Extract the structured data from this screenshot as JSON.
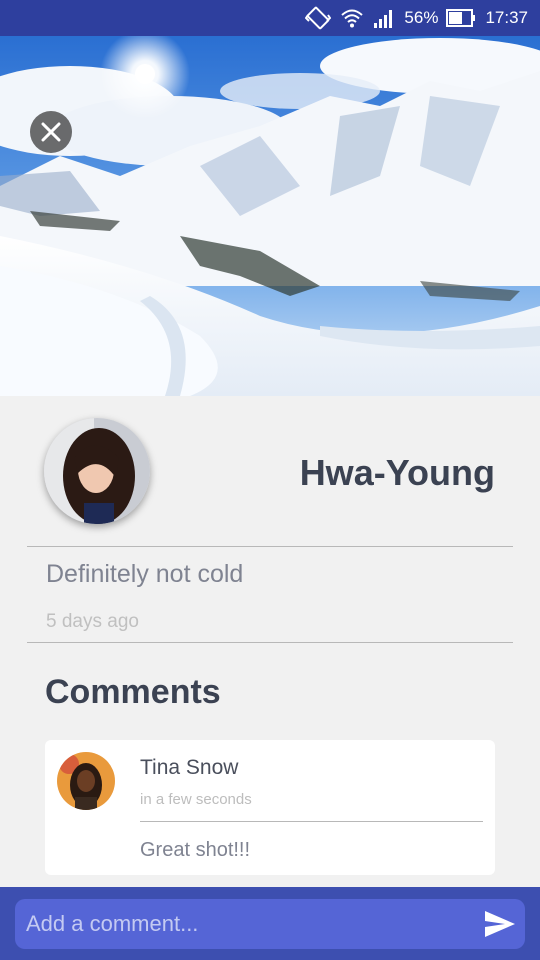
{
  "status_bar": {
    "battery_percent": "56%",
    "time": "17:37",
    "icons": [
      "vibrate-icon",
      "wifi-icon",
      "signal-icon",
      "battery-icon"
    ]
  },
  "hero": {
    "image": "snowy-mountain-landscape",
    "close_icon": "close-icon"
  },
  "post": {
    "author_name": "Hwa-Young",
    "caption": "Definitely not cold",
    "posted_time": "5 days ago"
  },
  "comments": {
    "heading": "Comments",
    "items": [
      {
        "author": "Tina Snow",
        "time": "in a few seconds",
        "text": "Great shot!!!"
      }
    ]
  },
  "composer": {
    "placeholder": "Add a comment...",
    "send_icon": "send-icon"
  },
  "colors": {
    "status_bar": "#2e3f9e",
    "input_bar": "#3d4fb0",
    "input_field": "#5565d6",
    "page_bg": "#f1f1f1",
    "heading_text": "#3b4252"
  }
}
